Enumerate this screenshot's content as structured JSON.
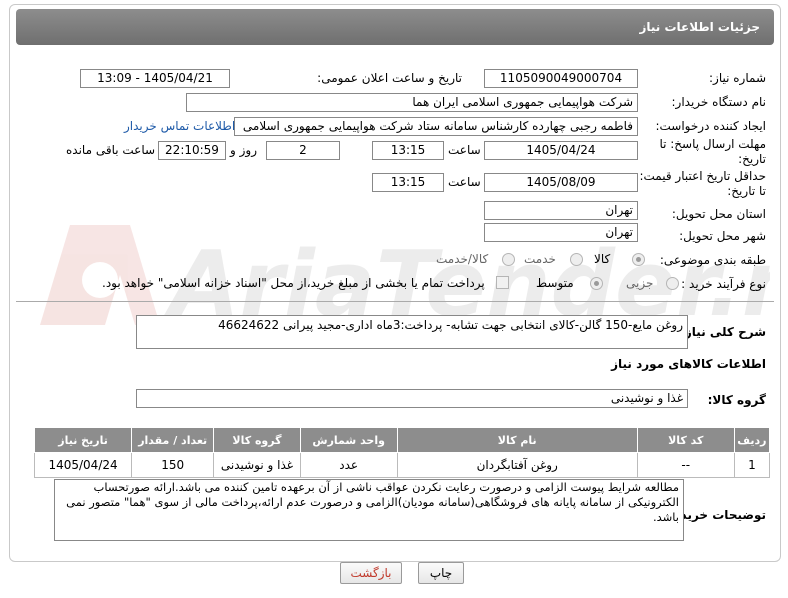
{
  "title": "جزئیات اطلاعات نیاز",
  "labels": {
    "need_number": "شماره نیاز:",
    "announce_datetime": "تاریخ و ساعت اعلان عمومی:",
    "buyer_org": "نام دستگاه خریدار:",
    "creator": "ایجاد کننده درخواست:",
    "reply_deadline": "مهلت ارسال پاسخ: تا تاریخ:",
    "price_validity": "حداقل تاریخ اعتبار قیمت: تا تاریخ:",
    "hour": "ساعت",
    "day_and": "روز و",
    "hours_left": "ساعت باقی مانده",
    "province": "استان محل تحویل:",
    "city": "شهر محل تحویل:",
    "category": "طبقه بندی موضوعی:",
    "process_type": "نوع فرآیند خرید :",
    "general_description": "شرح کلی نیاز:",
    "goods_info": "اطلاعات کالاهای مورد نیاز",
    "goods_group": "گروه کالا:",
    "buyer_notes": "توضیحات خریدار:"
  },
  "values": {
    "need_number": "1105090049000704",
    "announce_datetime": "1405/04/21 - 13:09",
    "buyer_org": "شرکت هواپیمایی جمهوری اسلامی ایران هما",
    "creator": "فاطمه رجبی چهارده کارشناس سامانه ستاد شرکت هواپیمایی جمهوری اسلامی",
    "contact_link": "اطلاعات تماس خریدار",
    "reply_date": "1405/04/24",
    "reply_time": "13:15",
    "reply_days": "2",
    "reply_remaining": "22:10:59",
    "validity_date": "1405/08/09",
    "validity_time": "13:15",
    "province": "تهران",
    "city": "تهران",
    "general_description": "روغن مایع-150 گالن-کالای انتخابی جهت تشابه- پرداخت:3ماه اداری-مجید پیرانی 46624622",
    "goods_group": "غذا و نوشیدنی",
    "buyer_notes": "مطالعه شرایط پیوست الزامی و درصورت رعایت نکردن عواقب ناشی از آن برعهده تامین کننده می باشد.ارائه صورتحساب الکترونیکی از سامانه پایانه های فروشگاهی(سامانه مودیان)الزامی و درصورت عدم ارائه،پرداخت مالی از سوی \"هما\" متصور نمی باشد."
  },
  "category_options": [
    {
      "label": "کالا",
      "selected": true
    },
    {
      "label": "خدمت",
      "selected": false
    },
    {
      "label": "کالا/خدمت",
      "selected": false
    }
  ],
  "process_options": [
    {
      "label": "جزیی",
      "selected": false
    },
    {
      "label": "متوسط",
      "selected": true
    }
  ],
  "payment_note": "پرداخت تمام یا بخشی از مبلغ خرید،از محل \"اسناد خزانه اسلامی\" خواهد بود.",
  "table": {
    "headers": [
      "ردیف",
      "کد کالا",
      "نام کالا",
      "واحد شمارش",
      "گروه کالا",
      "تعداد / مقدار",
      "تاریخ نیاز"
    ],
    "rows": [
      [
        "1",
        "--",
        "روغن آفتابگردان",
        "عدد",
        "غذا و نوشیدنی",
        "150",
        "1405/04/24"
      ]
    ]
  },
  "buttons": {
    "print": "چاپ",
    "back": "بازگشت"
  },
  "watermark": "AriaTender.neT",
  "colors": {
    "header": "#7d7d7d",
    "link": "#1e5aa8",
    "back_button_text": "#c0392b"
  }
}
